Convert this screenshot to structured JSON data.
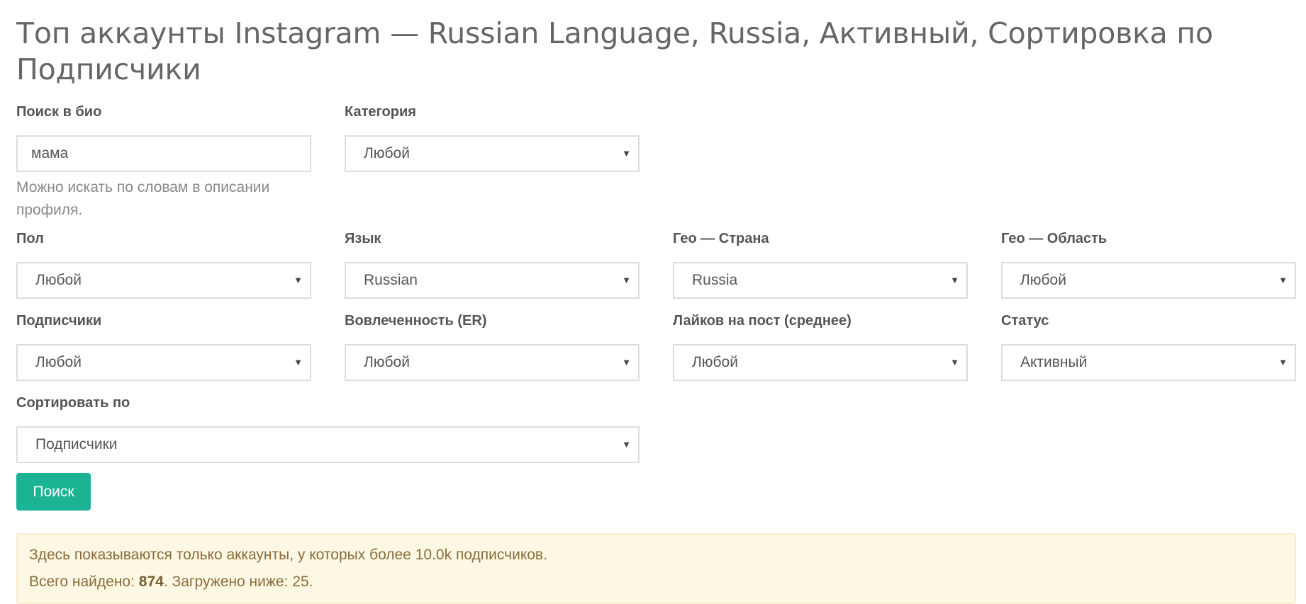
{
  "page": {
    "title": "Топ аккаунты Instagram — Russian Language, Russia, Активный, Сортировка по Подписчики"
  },
  "filters": {
    "bio_search": {
      "label": "Поиск в био",
      "value": "мама",
      "help": "Можно искать по словам в описании профиля."
    },
    "category": {
      "label": "Категория",
      "value": "Любой"
    },
    "gender": {
      "label": "Пол",
      "value": "Любой"
    },
    "language": {
      "label": "Язык",
      "value": "Russian"
    },
    "geo_country": {
      "label": "Гео — Страна",
      "value": "Russia"
    },
    "geo_region": {
      "label": "Гео — Область",
      "value": "Любой"
    },
    "followers": {
      "label": "Подписчики",
      "value": "Любой"
    },
    "engagement": {
      "label": "Вовлеченность (ER)",
      "value": "Любой"
    },
    "likes_per_post": {
      "label": "Лайков на пост (среднее)",
      "value": "Любой"
    },
    "status": {
      "label": "Статус",
      "value": "Активный"
    },
    "sort_by": {
      "label": "Сортировать по",
      "value": "Подписчики"
    }
  },
  "search_button": {
    "label": "Поиск"
  },
  "notice": {
    "line1": "Здесь показываются только аккаунты, у которых более 10.0k подписчиков.",
    "total_prefix": "Всего найдено: ",
    "total_count": "874",
    "loaded_text": ". Загружено ниже: 25."
  },
  "icons": {
    "select_arrow": "▼"
  },
  "colors": {
    "primary_button": "#1bb394",
    "notice_background": "#fcf8e3",
    "notice_text": "#8a6d3b"
  }
}
